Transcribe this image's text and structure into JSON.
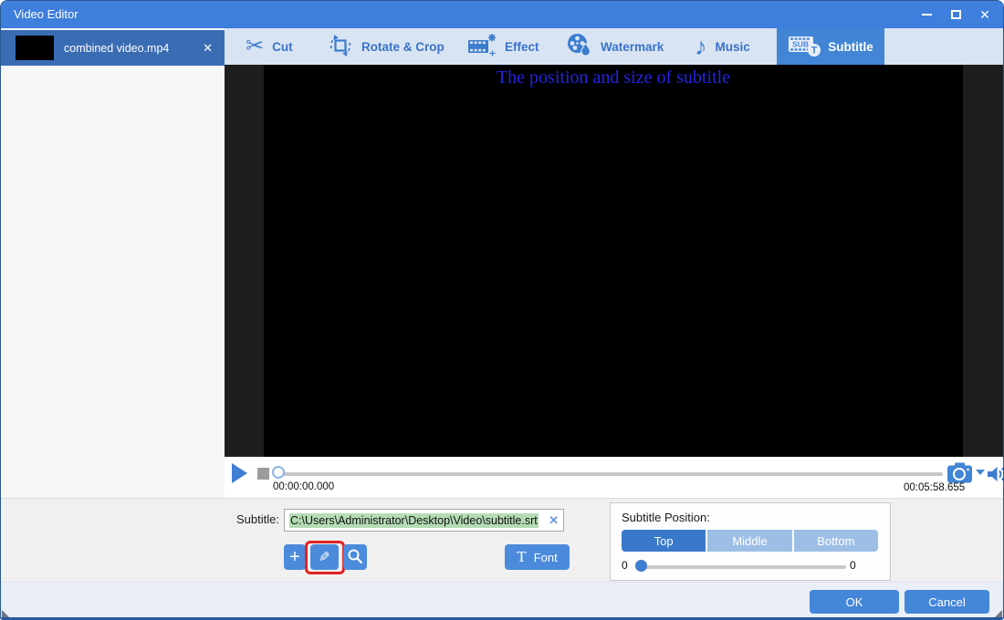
{
  "window": {
    "title": "Video Editor",
    "close_glyph": "✕"
  },
  "sidebar": {
    "file_name": "combined video.mp4",
    "close_glyph": "✕"
  },
  "tabs": [
    {
      "label": "Cut",
      "icon": "scissors-icon",
      "selected": false
    },
    {
      "label": "Rotate & Crop",
      "icon": "rotate-crop-icon",
      "selected": false
    },
    {
      "label": "Effect",
      "icon": "film-sparkle-icon",
      "selected": false
    },
    {
      "label": "Watermark",
      "icon": "film-reel-drop-icon",
      "selected": false
    },
    {
      "label": "Music",
      "icon": "music-note-icon",
      "selected": false
    },
    {
      "label": "Subtitle",
      "icon": "subtitle-sub-t-icon",
      "selected": true
    }
  ],
  "tab_glyphs": {
    "scissors": "✂",
    "music_note": "♪",
    "subtitle_sub": "SUB",
    "subtitle_t": "T"
  },
  "preview": {
    "overlay_text": "The position and size of subtitle"
  },
  "transport": {
    "current_time": "00:00:00.000",
    "total_time": "00:05:58.655"
  },
  "subtitle_section": {
    "label": "Subtitle:",
    "file_path": "C:\\Users\\Administrator\\Desktop\\Video\\subtitle.srt",
    "clear_glyph": "✕",
    "add_glyph": "+",
    "edit_glyph": "✎",
    "font_t": "T",
    "font_label": "Font"
  },
  "position_panel": {
    "label": "Subtitle Position:",
    "options": [
      {
        "label": "Top",
        "selected": true
      },
      {
        "label": "Middle",
        "selected": false
      },
      {
        "label": "Bottom",
        "selected": false
      }
    ],
    "slider_left": "0",
    "slider_right": "0"
  },
  "footer": {
    "ok": "OK",
    "cancel": "Cancel"
  },
  "colors": {
    "titlebar_blue": "#3e7edc",
    "selected_item_blue": "#3a6cb4",
    "tabbar_bg": "#d9e4f3",
    "accent": "#4285d6",
    "selection_green": "#b5dcb5",
    "highlight_red": "#e32222",
    "subtitle_text_blue": "#2323e1"
  }
}
